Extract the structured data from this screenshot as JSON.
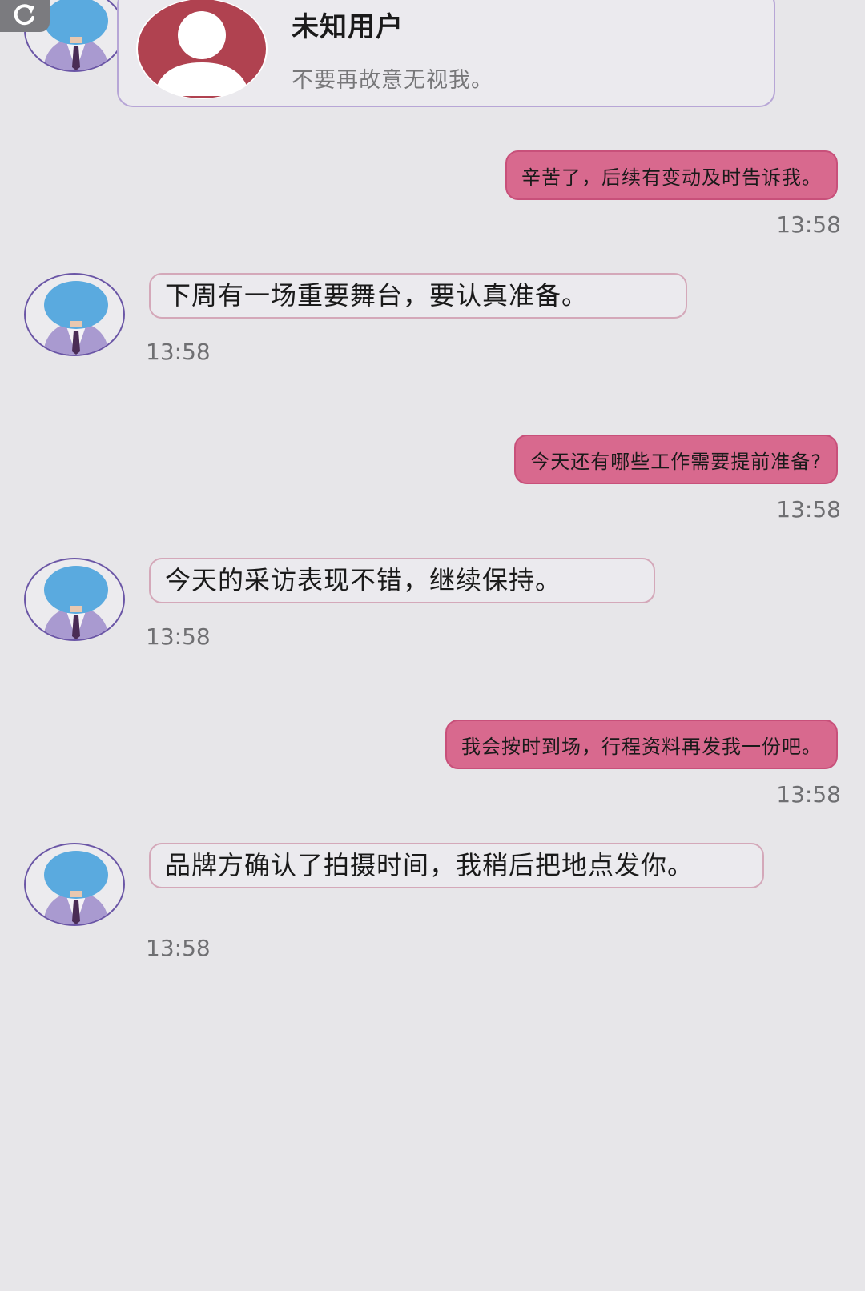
{
  "notification": {
    "name": "未知用户",
    "message": "不要再故意无视我。"
  },
  "messages": [
    {
      "side": "right",
      "text": "辛苦了，后续有变动及时告诉我。",
      "time": "13:58"
    },
    {
      "side": "left",
      "text": "下周有一场重要舞台，要认真准备。",
      "time": "13:58"
    },
    {
      "side": "right",
      "text": "今天还有哪些工作需要提前准备?",
      "time": "13:58"
    },
    {
      "side": "left",
      "text": "今天的采访表现不错，继续保持。",
      "time": "13:58"
    },
    {
      "side": "right",
      "text": "我会按时到场，行程资料再发我一份吧。",
      "time": "13:58"
    },
    {
      "side": "left",
      "text": "品牌方确认了拍摄时间，我稍后把地点发你。",
      "time": "13:58"
    }
  ],
  "icons": {
    "refresh": "refresh-icon",
    "contact_avatar": "person-in-suit-avatar",
    "unknown_avatar": "default-user-avatar"
  },
  "colors": {
    "background": "#e7e6e9",
    "outgoing_bubble": "#d8698e",
    "incoming_border": "#d4a8b9",
    "avatar_ring": "#6b56a6",
    "notification_border": "#b7a6d6",
    "default_avatar": "#b04250"
  }
}
